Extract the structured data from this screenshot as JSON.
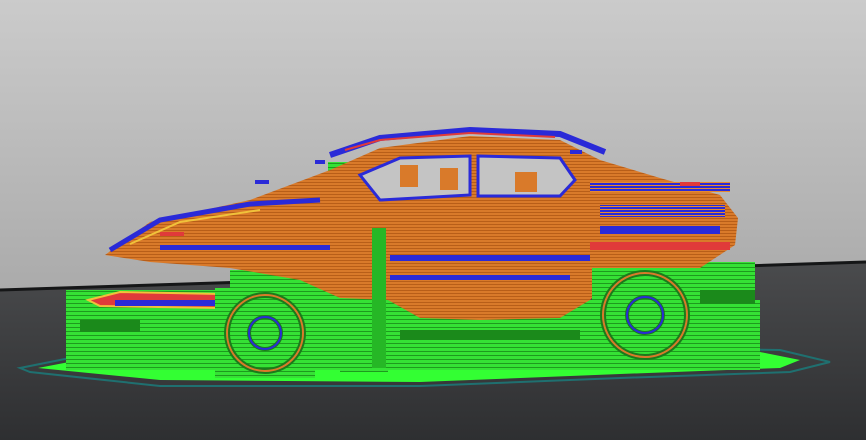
{
  "scene": {
    "background_top": "#c9c9c9",
    "background_bottom": "#9c9c9c",
    "floor_color": "#3f4042",
    "floor_edge_color": "#101112",
    "brim_color": "#32ff32",
    "brim_outline_color": "#1a6a6a",
    "support_color": "#35e135",
    "support_dark_color": "#1b8a1b",
    "perimeter_color": "#2626d8",
    "infill_color": "#d97a2a",
    "top_layer_color": "#e03a3a",
    "highlight_color": "#f0c23a"
  }
}
